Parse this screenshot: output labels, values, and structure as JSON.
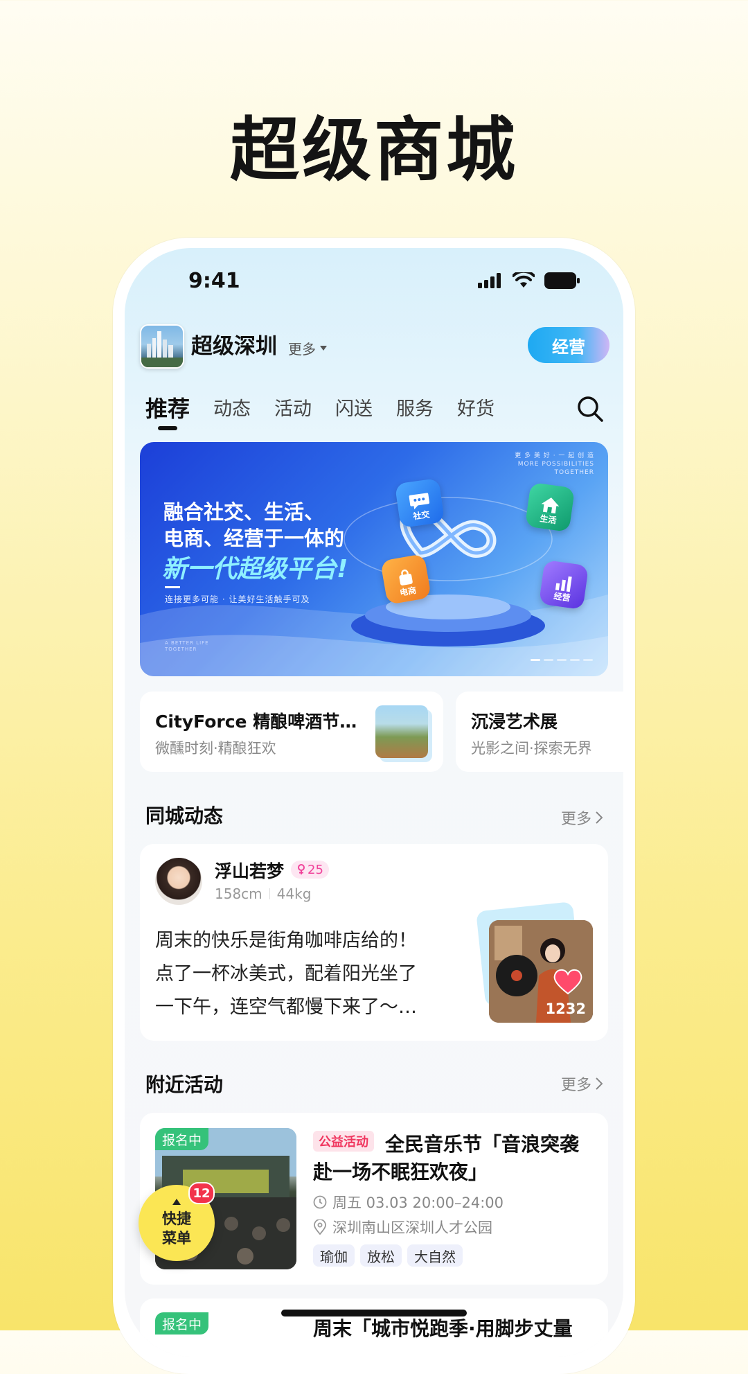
{
  "headline": "超级商城",
  "status_bar": {
    "time": "9:41"
  },
  "header": {
    "app_name": "超级深圳",
    "more_label": "更多",
    "manage_button": "经营"
  },
  "tabs": [
    "推荐",
    "动态",
    "活动",
    "闪送",
    "服务",
    "好货"
  ],
  "banner": {
    "top_text_1": "更 多 美 好 · 一 起 创 造",
    "top_text_2": "MORE POSSIBILITIES",
    "top_text_3": "TOGETHER",
    "line1": "融合社交、生活、",
    "line2": "电商、经营于一体的",
    "line3": "新一代超级平台!",
    "subtitle": "连接更多可能 · 让美好生活触手可及",
    "small_1": "A BETTER LIFE",
    "small_2": "TOGETHER",
    "icons": [
      {
        "label": "社交",
        "icon": "chat-icon",
        "color": "#2f8df5"
      },
      {
        "label": "生活",
        "icon": "home-icon",
        "color": "#1fb98a"
      },
      {
        "label": "电商",
        "icon": "bag-icon",
        "color": "#f59a2e"
      },
      {
        "label": "经营",
        "icon": "bar-chart-icon",
        "color": "#7b54f0"
      }
    ]
  },
  "featured": [
    {
      "title": "CityForce 精酿啤酒节…",
      "subtitle": "微醺时刻·精酿狂欢"
    },
    {
      "title": "沉浸艺术展",
      "subtitle": "光影之间·探索无界"
    }
  ],
  "city_feed": {
    "title": "同城动态",
    "more": "更多",
    "post": {
      "username": "浮山若梦",
      "age": "25",
      "height": "158cm",
      "weight": "44kg",
      "text_lines": [
        "周末的快乐是街角咖啡店给的！",
        "点了一杯冰美式，配着阳光坐了",
        "一下午，连空气都慢下来了～…"
      ],
      "likes": "1232"
    }
  },
  "nearby": {
    "title": "附近活动",
    "more": "更多",
    "activity": {
      "status": "报名中",
      "tag": "公益活动",
      "title_line1": "全民音乐节「音浪突袭",
      "title_line2": "赴一场不眠狂欢夜」",
      "time": "周五 03.03 20:00–24:00",
      "location": "深圳南山区深圳人才公园",
      "chips": [
        "瑜伽",
        "放松",
        "大自然"
      ]
    },
    "activity2": {
      "status": "报名中",
      "title": "周末「城市悦跑季·用脚步丈量"
    }
  },
  "fab": {
    "label_1": "快捷",
    "label_2": "菜单",
    "badge": "12"
  }
}
